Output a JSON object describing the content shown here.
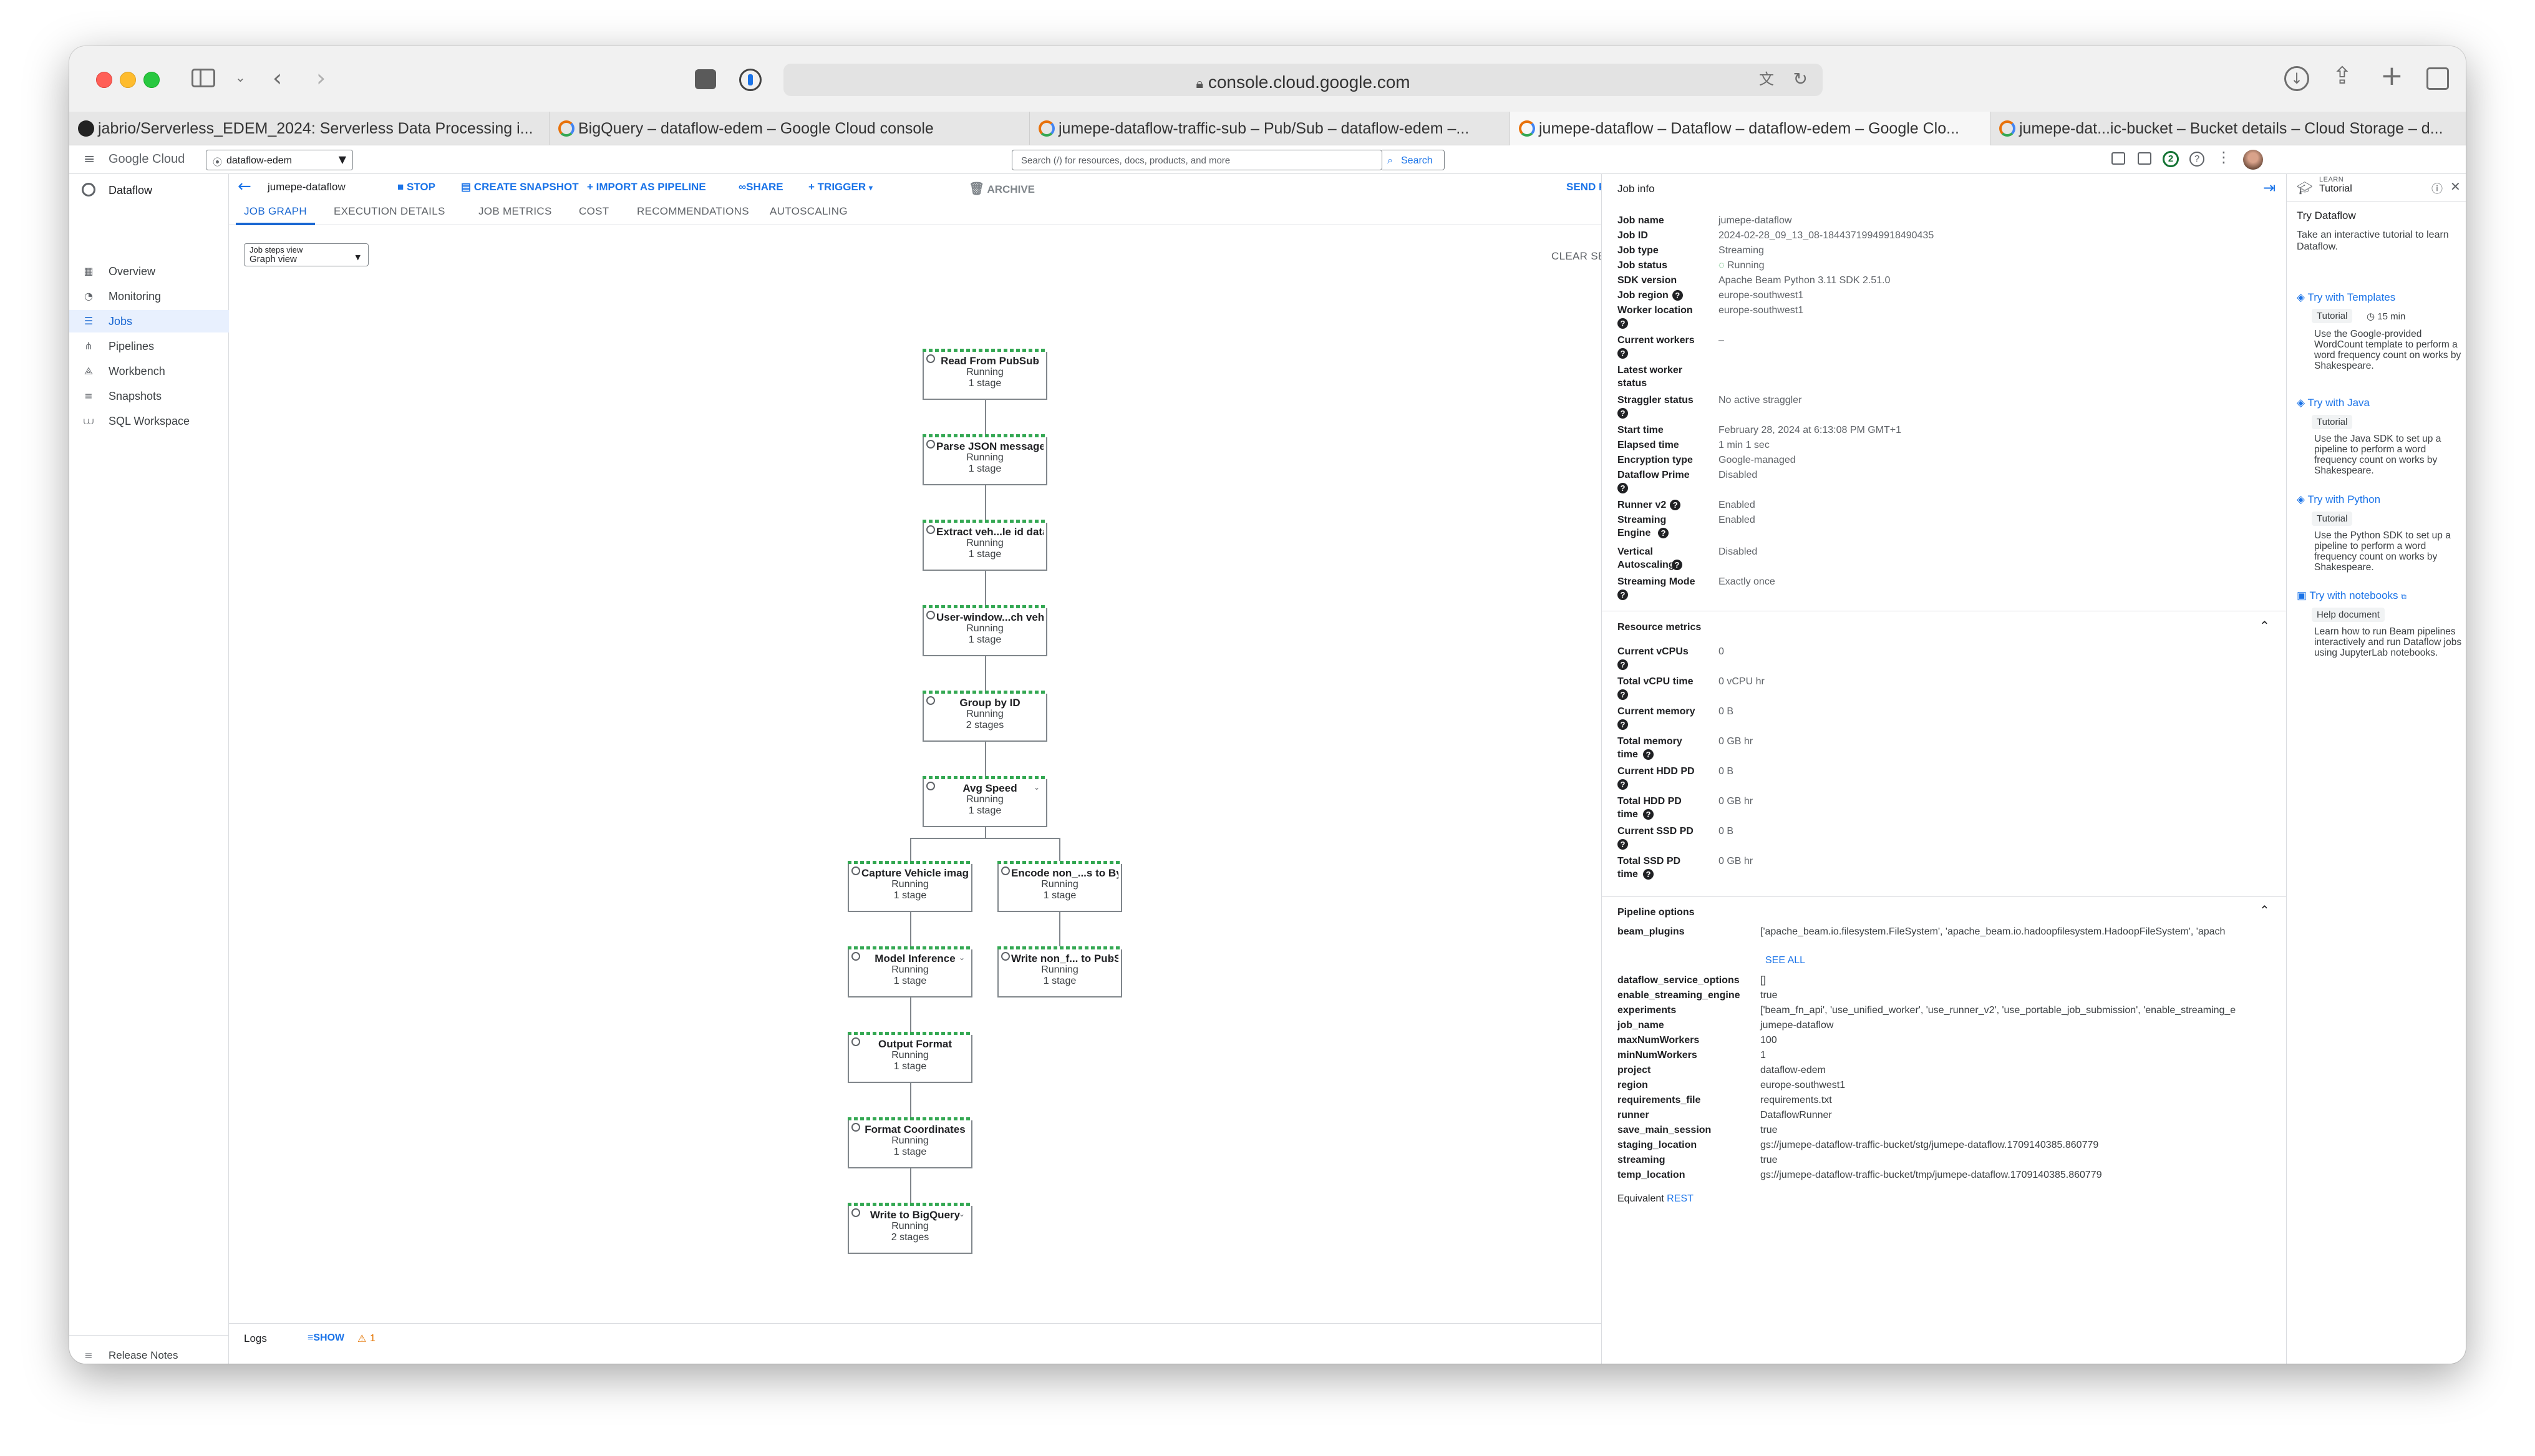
{
  "browser": {
    "url": "console.cloud.google.com",
    "tabs": [
      {
        "title": "jabrio/Serverless_EDEM_2024: Serverless Data Processing i...",
        "icon": "github-icon"
      },
      {
        "title": "BigQuery – dataflow-edem – Google Cloud console",
        "icon": "google-cloud-icon"
      },
      {
        "title": "jumepe-dataflow-traffic-sub – Pub/Sub – dataflow-edem –...",
        "icon": "google-cloud-icon"
      },
      {
        "title": "jumepe-dataflow – Dataflow – dataflow-edem – Google Clo...",
        "icon": "google-cloud-icon",
        "active": true
      },
      {
        "title": "jumepe-dat...ic-bucket – Bucket details – Cloud Storage – d...",
        "icon": "google-cloud-icon"
      }
    ]
  },
  "console": {
    "logo": "Google Cloud",
    "project": "dataflow-edem",
    "search_placeholder": "Search (/) for resources, docs, products, and more",
    "search_button": "Search",
    "notification_count": "2"
  },
  "nav": {
    "product": "Dataflow",
    "items": [
      "Overview",
      "Monitoring",
      "Jobs",
      "Pipelines",
      "Workbench",
      "Snapshots",
      "SQL Workspace"
    ],
    "active": "Jobs",
    "release_notes": "Release Notes",
    "collapse": "◂|"
  },
  "job": {
    "name": "jumepe-dataflow",
    "actions": {
      "stop": "STOP",
      "snapshot": "CREATE SNAPSHOT",
      "import": "IMPORT AS PIPELINE",
      "share": "SHARE",
      "trigger": "TRIGGER",
      "archive": "ARCHIVE",
      "feedback": "SEND FEEDBACK"
    },
    "tabs": [
      "JOB GRAPH",
      "EXECUTION DETAILS",
      "JOB METRICS",
      "COST",
      "RECOMMENDATIONS",
      "AUTOSCALING"
    ],
    "active_tab": "JOB GRAPH"
  },
  "graph": {
    "view_label": "Job steps view",
    "view_value": "Graph view",
    "clear_selection": "CLEAR SELECTION",
    "steps": [
      {
        "name": "Read From PubSub",
        "status": "Running",
        "stages": "1 stage"
      },
      {
        "name": "Parse JSON messages",
        "status": "Running",
        "stages": "1 stage"
      },
      {
        "name": "Extract veh...le id data",
        "status": "Running",
        "stages": "1 stage"
      },
      {
        "name": "User-window...ch vehicle",
        "status": "Running",
        "stages": "1 stage"
      },
      {
        "name": "Group by ID",
        "status": "Running",
        "stages": "2 stages"
      },
      {
        "name": "Avg Speed",
        "status": "Running",
        "stages": "1 stage"
      },
      {
        "name": "Capture Vehicle image",
        "status": "Running",
        "stages": "1 stage"
      },
      {
        "name": "Encode non_...s to Bytes",
        "status": "Running",
        "stages": "1 stage"
      },
      {
        "name": "Model Inference",
        "status": "Running",
        "stages": "1 stage"
      },
      {
        "name": "Write non_f... to PubSub",
        "status": "Running",
        "stages": "1 stage"
      },
      {
        "name": "Output Format",
        "status": "Running",
        "stages": "1 stage"
      },
      {
        "name": "Format Coordinates",
        "status": "Running",
        "stages": "1 stage"
      },
      {
        "name": "Write to BigQuery",
        "status": "Running",
        "stages": "2 stages"
      }
    ]
  },
  "logs": {
    "label": "Logs",
    "show": "SHOW",
    "warnings": "1"
  },
  "job_info": {
    "title": "Job info",
    "fields": [
      {
        "label": "Job name",
        "value": "jumepe-dataflow"
      },
      {
        "label": "Job ID",
        "value": "2024-02-28_09_13_08-18443719949918490435"
      },
      {
        "label": "Job type",
        "value": "Streaming"
      },
      {
        "label": "Job status",
        "value": "Running"
      },
      {
        "label": "SDK version",
        "value": "Apache Beam Python 3.11 SDK 2.51.0"
      },
      {
        "label": "Job region",
        "value": "europe-southwest1"
      },
      {
        "label": "Worker location",
        "value": "europe-southwest1"
      },
      {
        "label": "Current workers",
        "value": "–"
      },
      {
        "label": "Latest worker status",
        "value": ""
      },
      {
        "label": "Straggler status",
        "value": "No active straggler"
      },
      {
        "label": "Start time",
        "value": "February 28, 2024 at 6:13:08 PM GMT+1"
      },
      {
        "label": "Elapsed time",
        "value": "1 min 1 sec"
      },
      {
        "label": "Encryption type",
        "value": "Google-managed"
      },
      {
        "label": "Dataflow Prime",
        "value": "Disabled"
      },
      {
        "label": "Runner v2",
        "value": "Enabled"
      },
      {
        "label": "Streaming Engine",
        "value": "Enabled"
      },
      {
        "label": "Vertical Autoscaling",
        "value": "Disabled"
      },
      {
        "label": "Streaming Mode",
        "value": "Exactly once"
      }
    ],
    "resource_title": "Resource metrics",
    "resources": [
      {
        "label": "Current vCPUs",
        "value": "0"
      },
      {
        "label": "Total vCPU time",
        "value": "0 vCPU hr"
      },
      {
        "label": "Current memory",
        "value": "0 B"
      },
      {
        "label": "Total memory time",
        "value": "0 GB hr"
      },
      {
        "label": "Current HDD PD",
        "value": "0 B"
      },
      {
        "label": "Total HDD PD time",
        "value": "0 GB hr"
      },
      {
        "label": "Current SSD PD",
        "value": "0 B"
      },
      {
        "label": "Total SSD PD time",
        "value": "0 GB hr"
      }
    ],
    "pipeline_title": "Pipeline options",
    "beam_plugins_label": "beam_plugins",
    "beam_plugins_value": "['apache_beam.io.filesystem.FileSystem', 'apache_beam.io.hadoopfilesystem.HadoopFileSystem', 'apach",
    "see_all": "SEE ALL",
    "options": [
      {
        "label": "dataflow_service_options",
        "value": "[]"
      },
      {
        "label": "enable_streaming_engine",
        "value": "true"
      },
      {
        "label": "experiments",
        "value": "['beam_fn_api', 'use_unified_worker', 'use_runner_v2', 'use_portable_job_submission', 'enable_streaming_e"
      },
      {
        "label": "job_name",
        "value": "jumepe-dataflow"
      },
      {
        "label": "maxNumWorkers",
        "value": "100"
      },
      {
        "label": "minNumWorkers",
        "value": "1"
      },
      {
        "label": "project",
        "value": "dataflow-edem"
      },
      {
        "label": "region",
        "value": "europe-southwest1"
      },
      {
        "label": "requirements_file",
        "value": "requirements.txt"
      },
      {
        "label": "runner",
        "value": "DataflowRunner"
      },
      {
        "label": "save_main_session",
        "value": "true"
      },
      {
        "label": "staging_location",
        "value": "gs://jumepe-dataflow-traffic-bucket/stg/jumepe-dataflow.1709140385.860779"
      },
      {
        "label": "streaming",
        "value": "true"
      },
      {
        "label": "temp_location",
        "value": "gs://jumepe-dataflow-traffic-bucket/tmp/jumepe-dataflow.1709140385.860779"
      }
    ],
    "equivalent": "Equivalent",
    "rest": "REST"
  },
  "learn": {
    "header_small": "LEARN",
    "header": "Tutorial",
    "title": "Try Dataflow",
    "intro": "Take an interactive tutorial to learn Dataflow.",
    "items": [
      {
        "title": "Try with Templates",
        "badge": "Tutorial",
        "duration": "15 min",
        "desc": "Use the Google-provided WordCount template to perform a word frequency count on works by Shakespeare."
      },
      {
        "title": "Try with Java",
        "badge": "Tutorial",
        "duration": "",
        "desc": "Use the Java SDK to set up a pipeline to perform a word frequency count on works by Shakespeare."
      },
      {
        "title": "Try with Python",
        "badge": "Tutorial",
        "duration": "",
        "desc": "Use the Python SDK to set up a pipeline to perform a word frequency count on works by Shakespeare."
      },
      {
        "title": "Try with notebooks",
        "badge": "Help document",
        "duration": "",
        "desc": "Learn how to run Beam pipelines interactively and run Dataflow jobs using JupyterLab notebooks."
      }
    ]
  },
  "colors": {
    "accent": "#1a73e8",
    "running": "#34a853",
    "warning": "#f9ab00",
    "active_nav_bg": "#e8f0fe"
  }
}
